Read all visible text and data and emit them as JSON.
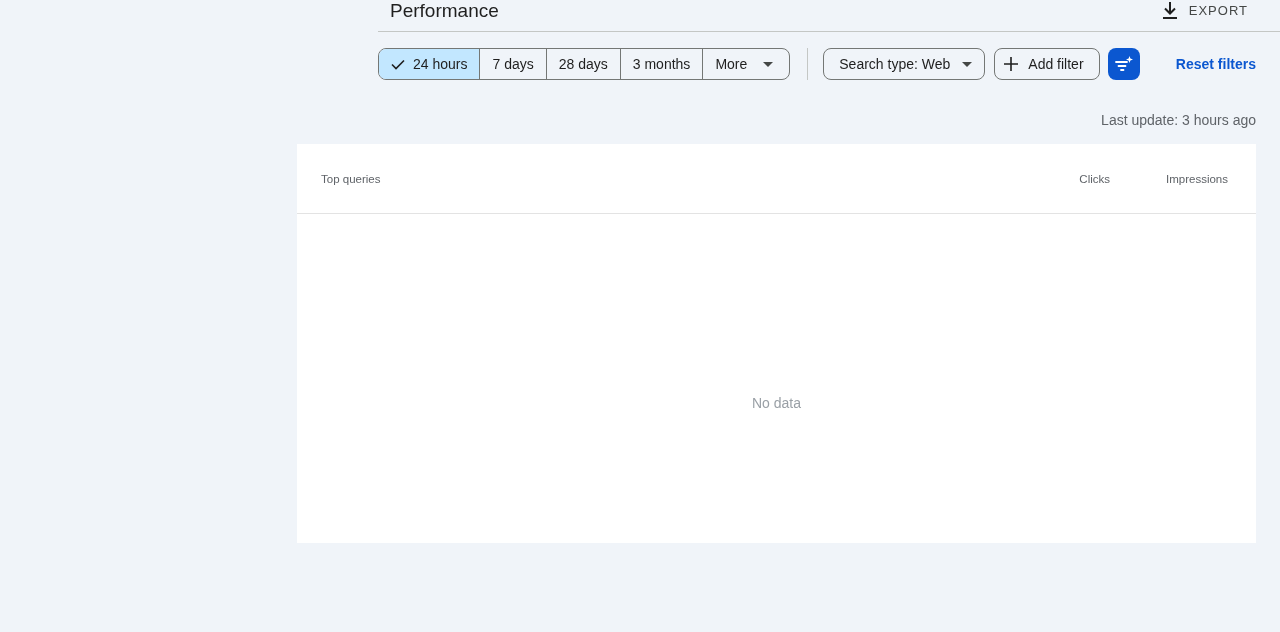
{
  "header": {
    "title": "Performance",
    "export_label": "EXPORT"
  },
  "filters": {
    "date_ranges": [
      {
        "label": "24 hours",
        "selected": true,
        "kind": "preset"
      },
      {
        "label": "7 days",
        "selected": false,
        "kind": "preset"
      },
      {
        "label": "28 days",
        "selected": false,
        "kind": "preset"
      },
      {
        "label": "3 months",
        "selected": false,
        "kind": "preset"
      },
      {
        "label": "More",
        "selected": false,
        "kind": "menu"
      }
    ],
    "search_type": "Search type: Web",
    "add_filter": "Add filter",
    "reset": "Reset filters"
  },
  "last_update": "Last update: 3 hours ago",
  "table": {
    "columns": [
      "Top queries",
      "Clicks",
      "Impressions"
    ],
    "empty_message": "No data"
  }
}
